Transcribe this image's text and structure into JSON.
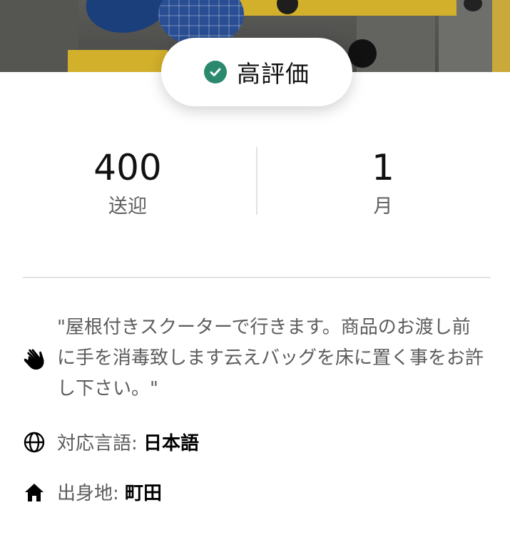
{
  "rating_badge": {
    "label": "高評価",
    "icon": "check-circle-icon",
    "color": "#2b8a6e"
  },
  "stats": [
    {
      "value": "400",
      "caption": "送迎"
    },
    {
      "value": "1",
      "caption": "月"
    }
  ],
  "profile": {
    "quote": "\"屋根付きスクーターで行きます。商品のお渡し前に手を消毒致します云えバッグを床に置く事をお許し下さい。\"",
    "quote_icon": "waving-hand-icon",
    "languages_label": "対応言語:",
    "languages_value": "日本語",
    "languages_icon": "globe-icon",
    "hometown_label": "出身地:",
    "hometown_value": "町田",
    "hometown_icon": "home-icon"
  }
}
